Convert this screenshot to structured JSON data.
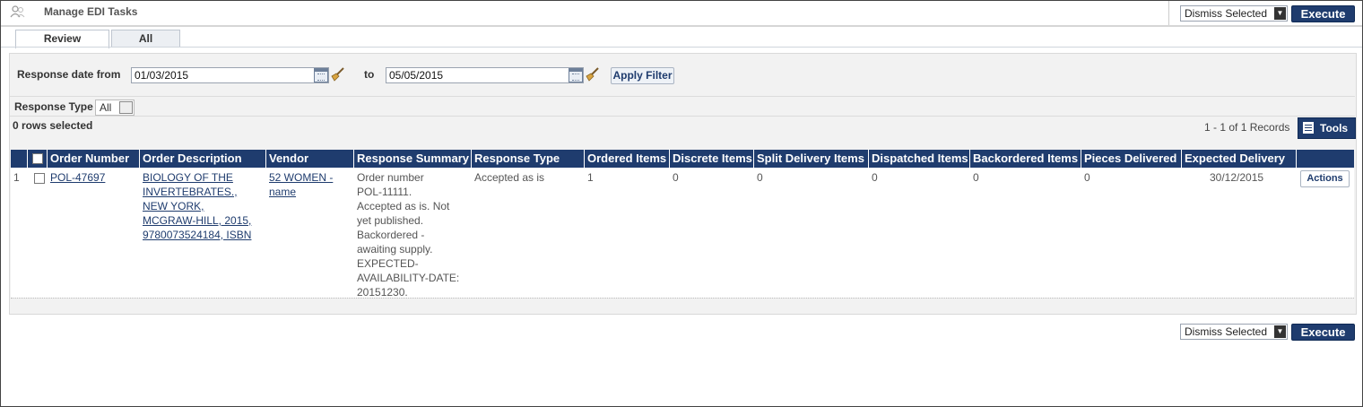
{
  "header": {
    "title": "Manage EDI Tasks",
    "dismiss_select": "Dismiss Selected",
    "execute_label": "Execute"
  },
  "tabs": [
    {
      "label": "Review",
      "active": true
    },
    {
      "label": "All",
      "active": false
    }
  ],
  "filter": {
    "from_label": "Response date from",
    "from_value": "01/03/2015",
    "to_label": "to",
    "to_value": "05/05/2015",
    "apply_label": "Apply Filter",
    "response_type_label": "Response Type",
    "response_type_value": "All"
  },
  "list": {
    "rows_selected": "0 rows selected",
    "records": "1 - 1 of 1 Records",
    "tools_label": "Tools"
  },
  "table": {
    "columns": [
      "Order Number",
      "Order Description",
      "Vendor",
      "Response Summary",
      "Response Type",
      "Ordered Items",
      "Discrete Items",
      "Split Delivery Items",
      "Dispatched Items",
      "Backordered Items",
      "Pieces Delivered",
      "Expected Delivery"
    ],
    "rows": [
      {
        "index": "1",
        "order_number": "POL-47697",
        "order_description": [
          "BIOLOGY OF THE",
          "INVERTEBRATES.,",
          "NEW YORK,",
          "MCGRAW-HILL, 2015,",
          "9780073524184, ISBN"
        ],
        "vendor": [
          "52 WOMEN -",
          "name"
        ],
        "response_summary": [
          "Order number",
          "POL-11111.",
          "Accepted as is. Not",
          "yet published.",
          "Backordered -",
          "awaiting supply.",
          "EXPECTED-",
          "AVAILABILITY-DATE:",
          "20151230."
        ],
        "response_type": "Accepted as is",
        "ordered_items": "1",
        "discrete_items": "0",
        "split_delivery_items": "0",
        "dispatched_items": "0",
        "backordered_items": "0",
        "pieces_delivered": "0",
        "expected_delivery": "30/12/2015",
        "actions_label": "Actions"
      }
    ]
  },
  "footer": {
    "dismiss_select": "Dismiss Selected",
    "execute_label": "Execute"
  },
  "colors": {
    "header_bg": "#1f3c6e",
    "link": "#1f3c6e",
    "panel_bg": "#f2f2f2"
  }
}
